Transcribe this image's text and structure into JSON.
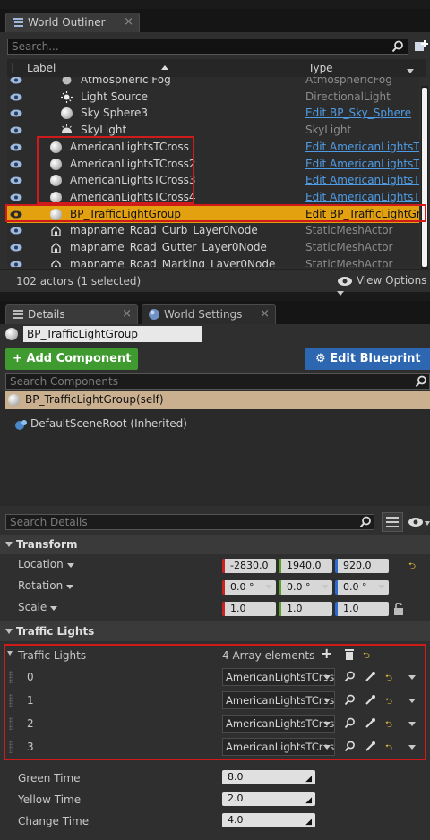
{
  "outliner": {
    "tab_title": "World Outliner",
    "search_placeholder": "Search...",
    "col_label": "Label",
    "col_type": "Type",
    "rows": [
      {
        "label": "Atmospheric Fog",
        "type": "AtmosphericFog",
        "type_link": false,
        "icon": "fog-icon"
      },
      {
        "label": "Light Source",
        "type": "DirectionalLight",
        "type_link": false,
        "icon": "sun-icon"
      },
      {
        "label": "Sky Sphere3",
        "type": "Edit BP_Sky_Sphere",
        "type_link": true,
        "icon": "sphere-icon"
      },
      {
        "label": "SkyLight",
        "type": "SkyLight",
        "type_link": false,
        "icon": "skylight-icon"
      },
      {
        "label": "AmericanLightsTCross",
        "type": "Edit AmericanLightsTCross",
        "type_link": true,
        "icon": "sphere-icon"
      },
      {
        "label": "AmericanLightsTCross2",
        "type": "Edit AmericanLightsTCross",
        "type_link": true,
        "icon": "sphere-icon"
      },
      {
        "label": "AmericanLightsTCross3",
        "type": "Edit AmericanLightsTCross",
        "type_link": true,
        "icon": "sphere-icon"
      },
      {
        "label": "AmericanLightsTCross4",
        "type": "Edit AmericanLightsTCross",
        "type_link": true,
        "icon": "sphere-icon"
      },
      {
        "label": "BP_TrafficLightGroup",
        "type": "Edit BP_TrafficLightGroup",
        "type_link": false,
        "icon": "sphere-icon"
      },
      {
        "label": "mapname_Road_Curb_Layer0Node",
        "type": "StaticMeshActor",
        "type_link": false,
        "icon": "mesh-icon"
      },
      {
        "label": "mapname_Road_Gutter_Layer0Node",
        "type": "StaticMeshActor",
        "type_link": false,
        "icon": "mesh-icon"
      },
      {
        "label": "mapname_Road_Marking_Layer0Node",
        "type": "StaticMeshActor",
        "type_link": false,
        "icon": "mesh-icon"
      }
    ],
    "status": "102 actors (1 selected)",
    "view_options": "View Options"
  },
  "details": {
    "tab_details": "Details",
    "tab_world_settings": "World Settings",
    "actor_name": "BP_TrafficLightGroup",
    "add_component": "Add Component",
    "edit_blueprint": "Edit Blueprint",
    "search_components_placeholder": "Search Components",
    "self_component": "BP_TrafficLightGroup(self)",
    "root_component": "DefaultSceneRoot (Inherited)",
    "search_details_placeholder": "Search Details",
    "transform": {
      "header": "Transform",
      "location_label": "Location",
      "location": [
        "-2830.0",
        "1940.0",
        "920.0"
      ],
      "rotation_label": "Rotation",
      "rotation": [
        "0.0 °",
        "0.0 °",
        "0.0 °"
      ],
      "scale_label": "Scale",
      "scale": [
        "1.0",
        "1.0",
        "1.0"
      ]
    },
    "traffic": {
      "header": "Traffic Lights",
      "array_label": "Traffic Lights",
      "array_count": "4 Array elements",
      "elements": [
        {
          "index": "0",
          "value": "AmericanLightsTCross"
        },
        {
          "index": "1",
          "value": "AmericanLightsTCross"
        },
        {
          "index": "2",
          "value": "AmericanLightsTCross"
        },
        {
          "index": "3",
          "value": "AmericanLightsTCross"
        }
      ],
      "green_label": "Green Time",
      "green_value": "8.0",
      "yellow_label": "Yellow Time",
      "yellow_value": "2.0",
      "change_label": "Change Time",
      "change_value": "4.0"
    }
  },
  "colors": {
    "selection": "#e3a10f",
    "link": "#4f9ce6",
    "highlight_box": "#d11a1a",
    "add_component_bg": "#3f9b2f",
    "edit_blueprint_bg": "#2e67b1"
  }
}
